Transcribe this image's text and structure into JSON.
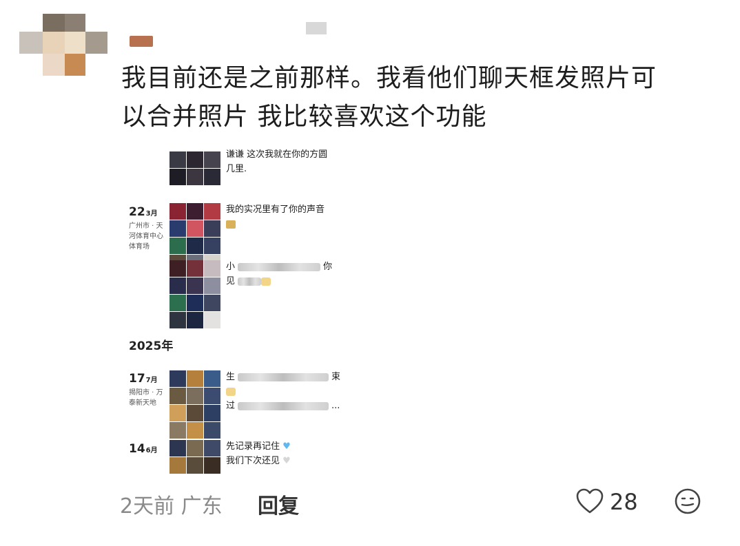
{
  "comment": {
    "text_line1": "我目前还是之前那样。我看他们聊天框发照片可",
    "text_line2": "以合并照片 我比较喜欢这个功能"
  },
  "screenshot": {
    "entry0": {
      "msg_line1": "谦谦 这次我就在你的方圆",
      "msg_line2": "几里."
    },
    "entry1": {
      "day": "22",
      "month": "3月",
      "place": "广州市 · 天河体育中心体育场",
      "msg1_line1": "我的实况里有了你的声音",
      "msg2_prefix": "小",
      "msg2_suffix": "你",
      "msg2_line2": "见"
    },
    "year": "2025年",
    "entry2": {
      "day": "17",
      "month": "7月",
      "place": "揭阳市 · 万泰新天地",
      "msg_prefix": "生",
      "msg_suffix": "束",
      "msg_line3_prefix": "过",
      "msg_line3_suffix": "..."
    },
    "entry3": {
      "day": "14",
      "month": "6月",
      "msg_line1": "先记录再记住",
      "msg_line2": "我们下次还见"
    }
  },
  "footer": {
    "time_location": "2天前 广东",
    "reply_label": "回复",
    "like_count": "28",
    "like_icon": "heart-outline-icon",
    "emoji_icon": "smiley-face-icon"
  }
}
